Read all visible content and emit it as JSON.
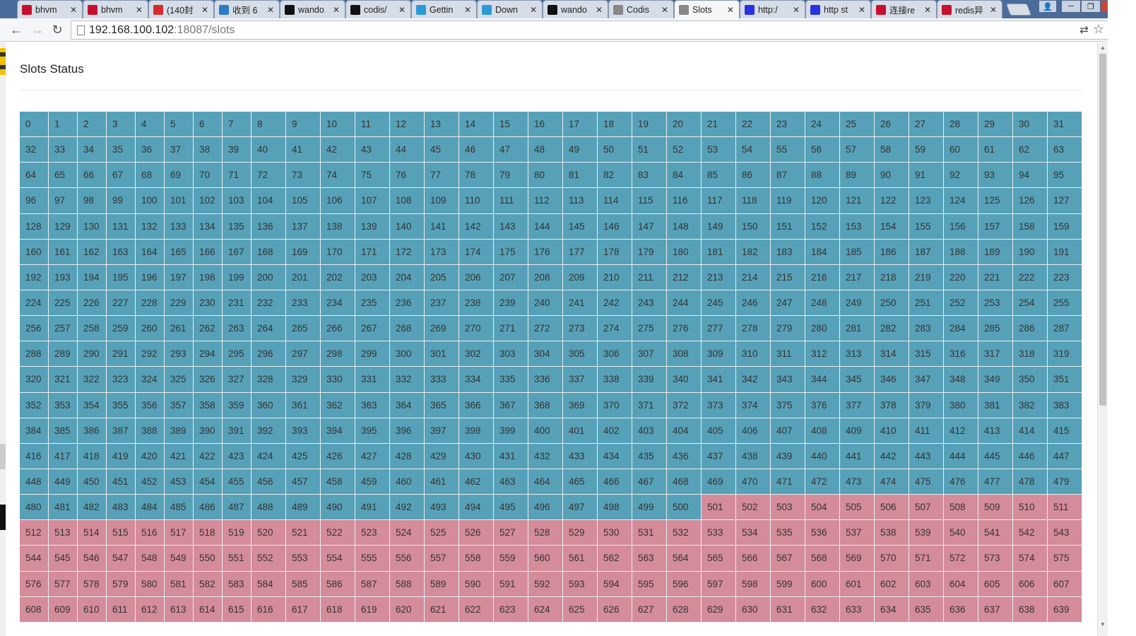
{
  "browser": {
    "tabs": [
      {
        "title": "bhvm",
        "icon": "zendesk-icon",
        "color": "#c8102e",
        "active": false
      },
      {
        "title": "bhvm",
        "icon": "zendesk-icon",
        "color": "#c8102e",
        "active": false
      },
      {
        "title": "(140封",
        "icon": "weibo-icon",
        "color": "#d52c2b",
        "active": false
      },
      {
        "title": "收到 6",
        "icon": "mail-icon",
        "color": "#2d7bc4",
        "active": false
      },
      {
        "title": "wando",
        "icon": "github-icon",
        "color": "#111111",
        "active": false
      },
      {
        "title": "codis/",
        "icon": "github-icon",
        "color": "#111111",
        "active": false
      },
      {
        "title": "Gettin",
        "icon": "docs-icon",
        "color": "#2a9ad6",
        "active": false
      },
      {
        "title": "Down",
        "icon": "docs-icon",
        "color": "#2a9ad6",
        "active": false
      },
      {
        "title": "wando",
        "icon": "github-icon",
        "color": "#111111",
        "active": false
      },
      {
        "title": "Codis",
        "icon": "page-icon",
        "color": "#888888",
        "active": false
      },
      {
        "title": "Slots",
        "icon": "page-icon",
        "color": "#888888",
        "active": true
      },
      {
        "title": "http:/",
        "icon": "baidu-icon",
        "color": "#2932e1",
        "active": false
      },
      {
        "title": "http st",
        "icon": "baidu-icon",
        "color": "#2932e1",
        "active": false
      },
      {
        "title": "连接re",
        "icon": "csdn-icon",
        "color": "#c8102e",
        "active": false
      },
      {
        "title": "redis异",
        "icon": "csdn-icon",
        "color": "#c8102e",
        "active": false
      }
    ],
    "tab_close_glyph": "✕",
    "url_host": "192.168.100.102",
    "url_rest": ":18087/slots"
  },
  "page": {
    "title": "Slots Status"
  },
  "slots": {
    "total": 640,
    "columns": 32,
    "boundary": 501,
    "colors": {
      "group_a": "#56a1b8",
      "group_b": "#d48b9a"
    }
  }
}
